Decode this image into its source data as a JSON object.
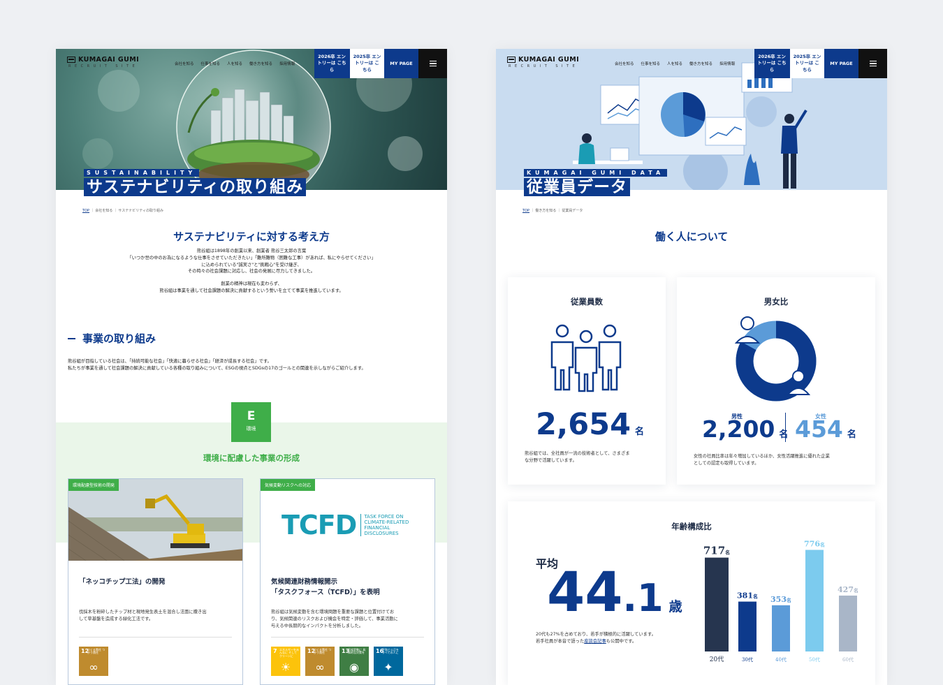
{
  "header": {
    "logo": "KUMAGAI GUMI",
    "logo_sub": "RECRUIT SITE",
    "nav": [
      "会社を知る",
      "仕事を知る",
      "人を知る",
      "働き方を知る",
      "採用情報"
    ],
    "entry_2026": "2026卒 エントリーは こちら",
    "entry_2025": "2025卒 エントリーは こちら",
    "mypage": "MY PAGE"
  },
  "left": {
    "hero_tag": "SUSTAINABILITY",
    "hero_title": "サステナビリティの取り組み",
    "breadcrumb": {
      "top": "TOP",
      "parent": "会社を知る",
      "current": "サステナビリティの取り組み"
    },
    "concept_title": "サステナビリティに対する考え方",
    "concept_lines": [
      "熊谷組は1898年の創業以来、創業者 熊谷三太郎の言葉",
      "「いつか世の中のお為になるような仕事をさせていただきたい」「難所難物（困難な工事）があれば、私にやらせてください」",
      "に込められている\"誠実さ\"と\"挑戦心\"を受け継ぎ、",
      "その時々の社会課題に対応し、社会の発展に尽力してきました。",
      "",
      "創業の精神は現在も変わらず、",
      "熊谷組は事業を通して社会課題の解決に貢献するという誓いを立てて事業を推進しています。"
    ],
    "business_title": "事業の取り組み",
    "business_lines": [
      "熊谷組が目指している社会は、「持続可能な社会」「快適に暮らせる社会」「経済が成長する社会」です。",
      "私たちが事業を通して社会課題の解決に貢献している各種の取り組みについて、ESGの視点とSDGsの17のゴールとの関連を示しながらご紹介します。"
    ],
    "esg_letter": "E",
    "esg_label": "環境",
    "env_title": "環境に配慮した事業の形成",
    "cards": [
      {
        "tag": "環境配慮型技術の開発",
        "title_lines": [
          "「ネッコチップ工法」の開発"
        ],
        "text_lines": [
          "伐採木を粉砕したチップ材と現地発生表土を混合し法面に撒き出",
          "して草基盤を造成する緑化工法です。"
        ],
        "sdgs": [
          {
            "num": "12",
            "label": "つくる責任 つかう責任",
            "color": "#bf8b2e",
            "symbol": "∞"
          }
        ]
      },
      {
        "tag": "気候変動リスクへの対応",
        "logo_big": "TCFD",
        "logo_small": [
          "TASK FORCE ON",
          "CLIMATE-RELATED",
          "FINANCIAL",
          "DISCLOSURES"
        ],
        "title_lines": [
          "気候関連財務情報開示",
          "「タスクフォース（TCFD）」を表明"
        ],
        "text_lines": [
          "熊谷組は気候変動を含む環境問題を重要な課題と位置付けてお",
          "り、気候関連のリスクおよび機会を特定・評価して、事業活動に",
          "与える中長期的なインパクトを分析しました。"
        ],
        "sdgs": [
          {
            "num": "7",
            "label": "エネルギーをみんなに そしてクリーンに",
            "color": "#fcc30b",
            "symbol": "☀"
          },
          {
            "num": "12",
            "label": "つくる責任 つかう責任",
            "color": "#bf8b2e",
            "symbol": "∞"
          },
          {
            "num": "13",
            "label": "気候変動に 具体的な対策を",
            "color": "#3f7e44",
            "symbol": "◉"
          },
          {
            "num": "16",
            "label": "平和と公正を すべての人に",
            "color": "#00689d",
            "symbol": "✦"
          }
        ]
      }
    ]
  },
  "right": {
    "hero_tag": "KUMAGAI GUMI DATA",
    "hero_title": "従業員データ",
    "breadcrumb": {
      "top": "TOP",
      "parent": "働き方を知る",
      "current": "従業員データ"
    },
    "section_title": "働く人について",
    "employees": {
      "title": "従業員数",
      "value": "2,654",
      "unit": "名",
      "text_lines": [
        "熊谷組では、全社員が一流の技術者として、さまざま",
        "な分野で活躍しています。"
      ]
    },
    "gender": {
      "title": "男女比",
      "male_label": "男性",
      "male_value": "2,200",
      "female_label": "女性",
      "female_value": "454",
      "unit": "名",
      "male_share": 0.829,
      "text_lines": [
        "女性の社員比率は年々増加しているほか、女性活躍推進に優れた企業",
        "としての認定も取得しています。"
      ]
    },
    "age": {
      "title": "年齢構成比",
      "avg_label": "平均",
      "avg_int": "44",
      "avg_dec": ".1",
      "avg_unit": "歳",
      "text_lines": [
        "20代も27%を占めており、若手が積極的に活躍しています。"
      ],
      "text_prefix": "若手社員が本音で語った",
      "text_link": "座談会記事",
      "text_suffix": "も公開中です。"
    }
  },
  "colors": {
    "brand": "#0d3a8c",
    "green": "#3fae49",
    "tcfd": "#1a9cb4"
  },
  "chart_data": {
    "type": "bar",
    "title": "年齢構成比",
    "categories": [
      "20代",
      "30代",
      "40代",
      "50代",
      "60代"
    ],
    "values": [
      717,
      381,
      353,
      776,
      427
    ],
    "value_unit": "名",
    "colors": [
      "#26354f",
      "#0d3a8c",
      "#5b9bd8",
      "#7ccbee",
      "#a9b6c8"
    ],
    "ylim": [
      0,
      800
    ]
  }
}
